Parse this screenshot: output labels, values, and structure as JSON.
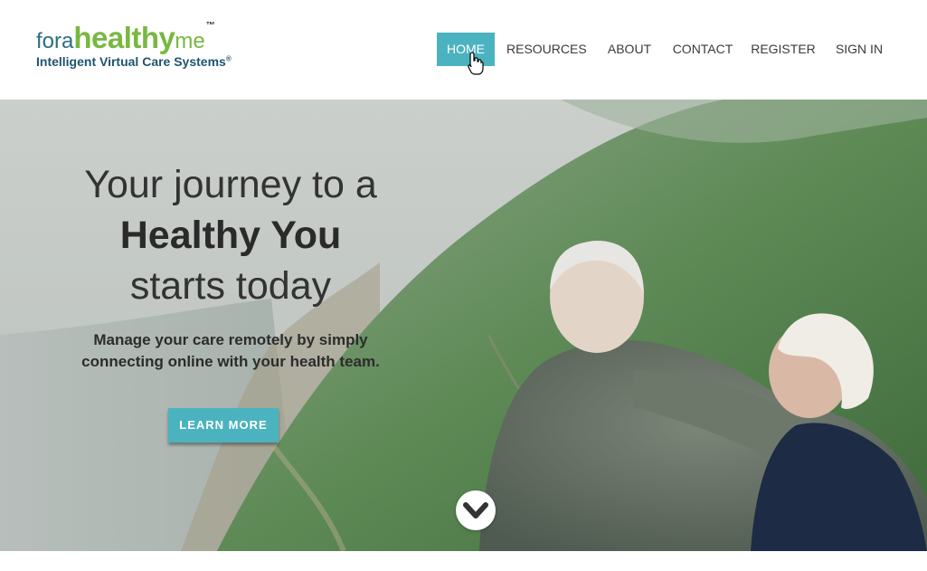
{
  "logo": {
    "for": "for",
    "a": "a",
    "healthy": "healthy",
    "me": "me",
    "tm": "™",
    "tagline": "Intelligent Virtual Care Systems",
    "registered": "®"
  },
  "nav": {
    "items": [
      {
        "label": "HOME",
        "active": true
      },
      {
        "label": "RESOURCES"
      },
      {
        "label": "ABOUT"
      },
      {
        "label": "CONTACT"
      },
      {
        "label": "REGISTER"
      },
      {
        "label": "SIGN IN"
      }
    ]
  },
  "hero": {
    "line1": "Your journey to a",
    "line2": "Healthy You",
    "line3": "starts today",
    "subtitle_1": "Manage your care remotely by simply",
    "subtitle_2": "connecting online with your health team.",
    "cta_label": "LEARN MORE",
    "scroll_icon": "chevron-down-icon"
  },
  "colors": {
    "accent": "#4bb3bf",
    "logo_green": "#78b840",
    "logo_blue": "#2d6e80"
  }
}
